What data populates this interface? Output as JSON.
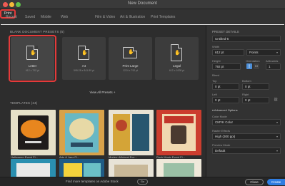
{
  "window": {
    "title": "New Document"
  },
  "tabs": [
    {
      "label": "Recent"
    },
    {
      "label": "Saved"
    },
    {
      "label": "Mobile"
    },
    {
      "label": "Web"
    },
    {
      "label": "Print"
    },
    {
      "label": "Film & Video"
    },
    {
      "label": "Art & Illustration"
    },
    {
      "label": "Print Templates"
    }
  ],
  "presets_header": "BLANK DOCUMENT PRESETS (5)",
  "presets": [
    {
      "name": "Letter",
      "size": "612 x 792 pt"
    },
    {
      "name": "A4",
      "size": "595.28 x 841.89 pt"
    },
    {
      "name": "Print Large",
      "size": "1224 x 792 pt"
    },
    {
      "name": "Legal",
      "size": "612 x 1008 pt"
    }
  ],
  "view_all": "View All Presets +",
  "templates_header": "TEMPLATES (24)",
  "templates": [
    {
      "caption": "Halloween Event Fl..."
    },
    {
      "caption": "Arts & Jazz Fl..."
    },
    {
      "caption": "Modern Minimal Eve..."
    },
    {
      "caption": "Rock Music Event Fl..."
    }
  ],
  "find_more": "Find more templates on Adobe Stock",
  "go_label": "Go",
  "close_label": "Close",
  "create_label": "Create",
  "details": {
    "header": "PRESET DETAILS",
    "name": "Untitled-5",
    "width_label": "Width",
    "width_value": "612 pt",
    "units": "Points",
    "height_label": "Height",
    "height_value": "792 pt",
    "orientation_label": "Orientation",
    "artboards_label": "Artboards",
    "artboards_value": "1",
    "bleed_label": "Bleed",
    "top_label": "Top",
    "bottom_label": "Bottom",
    "left_label": "Left",
    "right_label": "Right",
    "bleed_top": "0 pt",
    "bleed_bottom": "0 pt",
    "bleed_left": "0 pt",
    "bleed_right": "0 pt",
    "advanced_label": "Advanced Options",
    "color_mode_label": "Color Mode",
    "color_mode_value": "CMYK Color",
    "raster_label": "Raster Effects",
    "raster_value": "High (300 ppi)",
    "preview_label": "Preview Mode",
    "preview_value": "Default"
  }
}
